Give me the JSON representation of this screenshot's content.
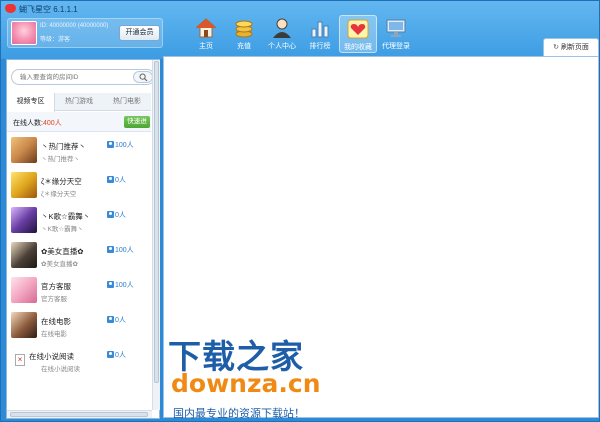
{
  "window": {
    "title": "蝴飞星空 6.1.1.1"
  },
  "user": {
    "id_text": "ID: 40000000 (40000000)",
    "level_text": "等级：游客",
    "vip_button": "开通会员"
  },
  "nav": {
    "items": [
      {
        "label": "主页",
        "icon": "home-icon"
      },
      {
        "label": "充值",
        "icon": "coins-icon"
      },
      {
        "label": "个人中心",
        "icon": "user-icon"
      },
      {
        "label": "排行榜",
        "icon": "bar-chart-icon"
      },
      {
        "label": "我的收藏",
        "icon": "heart-icon"
      },
      {
        "label": "代理登录",
        "icon": "monitor-icon"
      }
    ],
    "active_index": 4
  },
  "browser": {
    "refresh_label": "刷新页面"
  },
  "search": {
    "placeholder": "输入要查询的房间ID"
  },
  "tabs": [
    "视频专区",
    "热门游戏",
    "热门电影"
  ],
  "online": {
    "label": "在线人数:",
    "count": "400人",
    "enter_button": "快速进"
  },
  "rooms": [
    {
      "name": "丶热门推荐丶",
      "sub": "丶热门推荐丶",
      "count": "100人",
      "thumb_color": "#c9884a"
    },
    {
      "name": "ζ＊缘分天空",
      "sub": "ζ＊缘分天空",
      "count": "0人",
      "thumb_color": "#e0a81f"
    },
    {
      "name": "丶K歌☆霸舞丶",
      "sub": "丶K歌☆霸舞丶",
      "count": "0人",
      "thumb_color": "#6a3fa3"
    },
    {
      "name": "✿美女直播✿",
      "sub": "✿美女直播✿",
      "count": "100人",
      "thumb_color": "#4b4036"
    },
    {
      "name": "官方客服",
      "sub": "官方客服",
      "count": "100人",
      "thumb_color": "#f3a7c0"
    },
    {
      "name": "在线电影",
      "sub": "在线电影",
      "count": "0人",
      "thumb_color": "#8a5a3c"
    },
    {
      "name": "在线小说阅读",
      "sub": "在线小说阅读",
      "count": "0人",
      "thumb_color": "",
      "broken": true
    }
  ],
  "watermark": {
    "cn": "下载之家",
    "en": "downza.cn",
    "tagline": "国内最专业的资源下载站！"
  },
  "colors": {
    "accent": "#2d8ad6",
    "count_red": "#e2421b",
    "enter_green": "#4da634",
    "watermark_blue": "#1e5ea8",
    "watermark_orange": "#f08a14"
  }
}
